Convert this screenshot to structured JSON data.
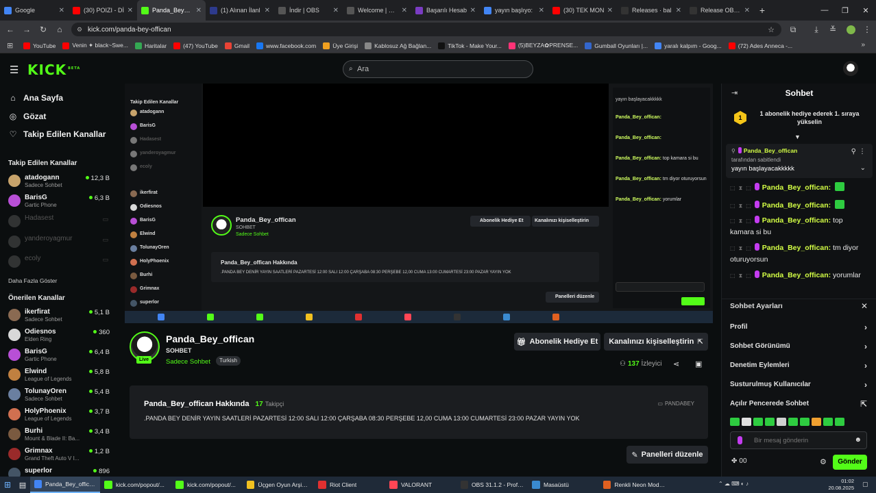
{
  "browser": {
    "tabs": [
      {
        "title": "Google",
        "color": "#4285f4"
      },
      {
        "title": "(30) POIZI - Dİ",
        "color": "#ff0000"
      },
      {
        "title": "Panda_Bey_off",
        "color": "#53fc18",
        "active": true
      },
      {
        "title": "(1) Alınan İlanl",
        "color": "#2d3a8c"
      },
      {
        "title": "İndir | OBS",
        "color": "#555555"
      },
      {
        "title": "Welcome | OBS",
        "color": "#555555"
      },
      {
        "title": "Başarılı Hesab",
        "color": "#7a3cc2"
      },
      {
        "title": "yayın başlıyo:",
        "color": "#4285f4"
      },
      {
        "title": "(30) TEK MON",
        "color": "#ff0000"
      },
      {
        "title": "Releases · bal",
        "color": "#333333"
      },
      {
        "title": "Release OBS S",
        "color": "#333333"
      }
    ],
    "new_tab": "+",
    "url": "kick.com/panda-bey-offican",
    "bookmarks": [
      {
        "label": "YouTube",
        "color": "#ff0000"
      },
      {
        "label": "Venin ✦ black~Swe...",
        "color": "#ff0000"
      },
      {
        "label": "Haritalar",
        "color": "#34a853"
      },
      {
        "label": "(47) YouTube",
        "color": "#ff0000"
      },
      {
        "label": "Gmail",
        "color": "#ea4335"
      },
      {
        "label": "www.facebook.com",
        "color": "#1877f2"
      },
      {
        "label": "Üye Girişi",
        "color": "#f0a020"
      },
      {
        "label": "Kablosuz Ağ Bağlan...",
        "color": "#888888"
      },
      {
        "label": "TikTok - Make Your...",
        "color": "#111111"
      },
      {
        "label": "(5)BEYZA✿PRENSE...",
        "color": "#ff3377"
      },
      {
        "label": "Gumball Oyunları |...",
        "color": "#3366cc"
      },
      {
        "label": "yaralı kalpım - Goog...",
        "color": "#4285f4"
      },
      {
        "label": "(72) Ades Anneca -...",
        "color": "#ff0000"
      }
    ]
  },
  "kick": {
    "logo": "KICK",
    "logo_badge": "BETA",
    "search_placeholder": "Ara",
    "nav": [
      {
        "label": "Ana Sayfa",
        "icon": "home-icon"
      },
      {
        "label": "Gözat",
        "icon": "compass-icon"
      },
      {
        "label": "Takip Edilen Kanallar",
        "icon": "heart-icon"
      }
    ],
    "followed_title": "Takip Edilen Kanallar",
    "followed": [
      {
        "name": "atadogann",
        "sub": "Sadece Sohbet",
        "viewers": "12,3 B",
        "color": "#c7a36b"
      },
      {
        "name": "BarisG",
        "sub": "Gartic Phone",
        "viewers": "6,3 B",
        "color": "#b84fd6"
      },
      {
        "name": "Hadasest",
        "offline": true,
        "color": "#777777"
      },
      {
        "name": "yanderoyagmur",
        "offline": true,
        "color": "#777777"
      },
      {
        "name": "ecoly",
        "offline": true,
        "color": "#777777"
      }
    ],
    "show_more": "Daha Fazla Göster",
    "recommended_title": "Önerilen Kanallar",
    "recommended": [
      {
        "name": "ikerfirat",
        "sub": "Sadece Sohbet",
        "viewers": "5,1 B",
        "color": "#8a6a52"
      },
      {
        "name": "Odiesnos",
        "sub": "Elden Ring",
        "viewers": "360",
        "color": "#d8d8d8"
      },
      {
        "name": "BarisG",
        "sub": "Gartic Phone",
        "viewers": "6,4 B",
        "color": "#b84fd6"
      },
      {
        "name": "Elwind",
        "sub": "League of Legends",
        "viewers": "5,8 B",
        "color": "#c08040"
      },
      {
        "name": "TolunayOren",
        "sub": "Sadece Sohbet",
        "viewers": "5,4 B",
        "color": "#6a7fa0"
      },
      {
        "name": "HolyPhoenix",
        "sub": "League of Legends",
        "viewers": "3,7 B",
        "color": "#d07050"
      },
      {
        "name": "Burhi",
        "sub": "Mount & Blade II: Ba...",
        "viewers": "3,4 B",
        "color": "#7a5a40"
      },
      {
        "name": "Grimnax",
        "sub": "Grand Theft Auto V I...",
        "viewers": "1,2 B",
        "color": "#9a2a2a"
      },
      {
        "name": "superlor",
        "sub": "",
        "viewers": "896",
        "color": "#445566"
      }
    ]
  },
  "channel": {
    "name": "Panda_Bey_offican",
    "category": "SOHBET",
    "subcategory": "Sadece Sohbet",
    "tag": "Turkish",
    "live_badge": "Live",
    "gift_sub": "Abonelik Hediye Et",
    "customize": "Kanalınızı kişiselleştirin",
    "viewers": "137",
    "viewers_label": "İzleyici",
    "about_title": "Panda_Bey_offican Hakkında",
    "followers": "17",
    "followers_label": "Takipçi",
    "panel_badge": "PANDABEY",
    "about_text": ".PANDA BEY DENİR YAYIN SAATLERİ PAZARTESİ 12:00 SALI 12:00 ÇARŞABA 08:30 PERŞEBE 12,00 CUMA 13:00 CUMARTESİ 23:00 PAZAR YAYIN YOK",
    "edit_panels": "Panelleri düzenle"
  },
  "chat": {
    "title": "Sohbet",
    "gift_banner": "1 abonelik hediye ederek 1. sıraya yükselin",
    "gift_rank": "1",
    "pinned_user": "Panda_Bey_offican",
    "pinned_by": "tarafından sabitlendi",
    "pinned_text": "yayın başlayacakkkkk",
    "messages": [
      {
        "user": "Panda_Bey_offican:",
        "text": "",
        "emote": true
      },
      {
        "user": "Panda_Bey_offican:",
        "text": "",
        "emote": true
      },
      {
        "user": "Panda_Bey_offican:",
        "text": "top kamara si bu"
      },
      {
        "user": "Panda_Bey_offican:",
        "text": "tm diyor oturuyorsun"
      },
      {
        "user": "Panda_Bey_offican:",
        "text": "yorumlar"
      }
    ],
    "settings_title": "Sohbet Ayarları",
    "settings": [
      "Profil",
      "Sohbet Görünümü",
      "Denetim Eylemleri",
      "Susturulmuş Kullanıcılar",
      "Açılır Pencerede Sohbet"
    ],
    "input_placeholder": "Bir mesaj gönderin",
    "send": "Gönder",
    "points": "00"
  },
  "taskbar": {
    "items": [
      {
        "label": "Panda_Bey_offican...",
        "color": "#4285f4"
      },
      {
        "label": "kick.com/popout/...",
        "color": "#53fc18"
      },
      {
        "label": "kick.com/popout/...",
        "color": "#53fc18"
      },
      {
        "label": "Üçgen Oyun Arşivi ...",
        "color": "#f0c020"
      },
      {
        "label": "Riot Client",
        "color": "#e03030"
      },
      {
        "label": "VALORANT",
        "color": "#ff4655"
      },
      {
        "label": "OBS 31.1.2 - Profil: ...",
        "color": "#333333"
      },
      {
        "label": "Masaüstü",
        "color": "#3a8ad0"
      },
      {
        "label": "Renkli Neon Moder...",
        "color": "#e06020"
      }
    ],
    "time": "01:02",
    "date": "20.08.2025"
  }
}
